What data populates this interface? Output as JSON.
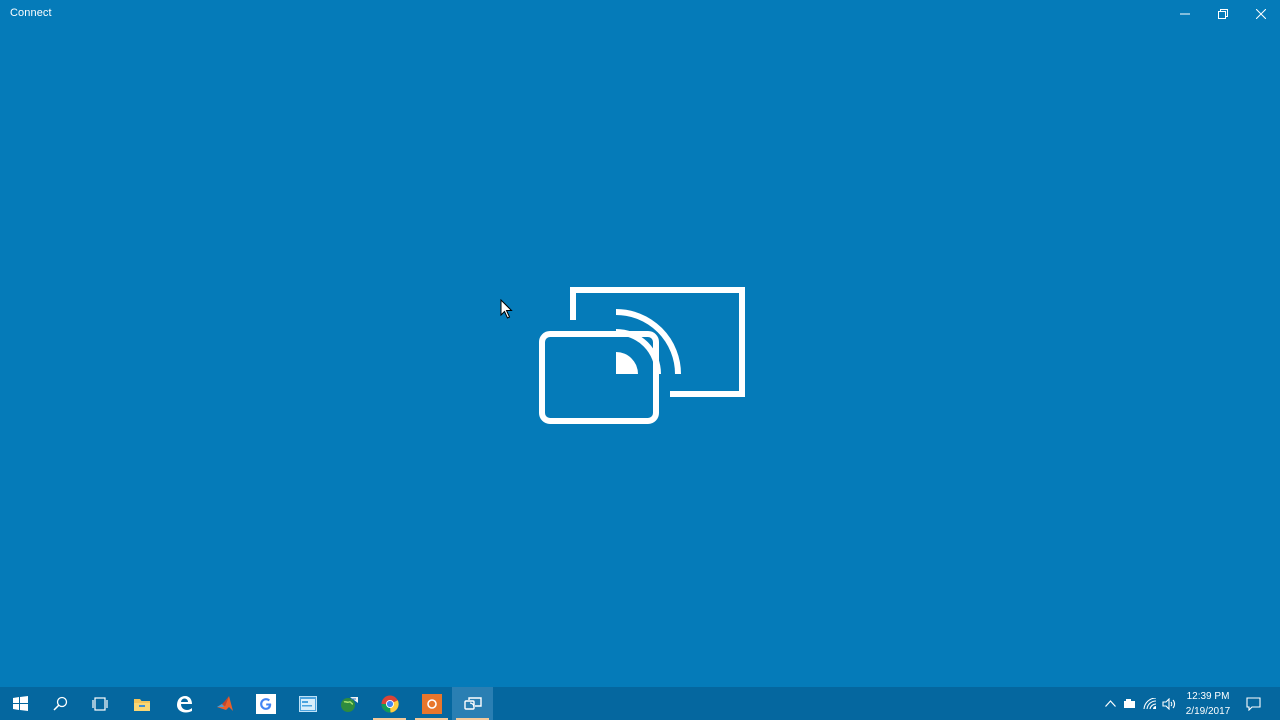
{
  "window": {
    "title": "Connect",
    "minimize_icon": "minimize-icon",
    "restore_icon": "restore-icon",
    "close_icon": "close-icon"
  },
  "colors": {
    "background": "#057bb9",
    "taskbar": "#05679f",
    "foreground": "#ffffff"
  },
  "splash": {
    "icon": "connect-cast-icon"
  },
  "taskbar": {
    "items": [
      {
        "icon": "windows-start-icon"
      },
      {
        "icon": "search-icon"
      },
      {
        "icon": "task-view-icon"
      },
      {
        "icon": "file-explorer-icon"
      },
      {
        "icon": "edge-browser-icon"
      },
      {
        "icon": "matlab-icon"
      },
      {
        "icon": "google-icon"
      },
      {
        "icon": "app-window-icon"
      },
      {
        "icon": "globe-app-icon"
      },
      {
        "icon": "chrome-icon"
      },
      {
        "icon": "recorder-app-icon"
      },
      {
        "icon": "connect-app-icon"
      }
    ],
    "tray": {
      "chevron_icon": "chevron-up-icon",
      "battery_icon": "battery-icon",
      "wifi_icon": "wifi-icon",
      "volume_icon": "volume-icon",
      "notification_icon": "notification-icon"
    },
    "clock": {
      "time": "12:39 PM",
      "date": "2/19/2017"
    }
  }
}
